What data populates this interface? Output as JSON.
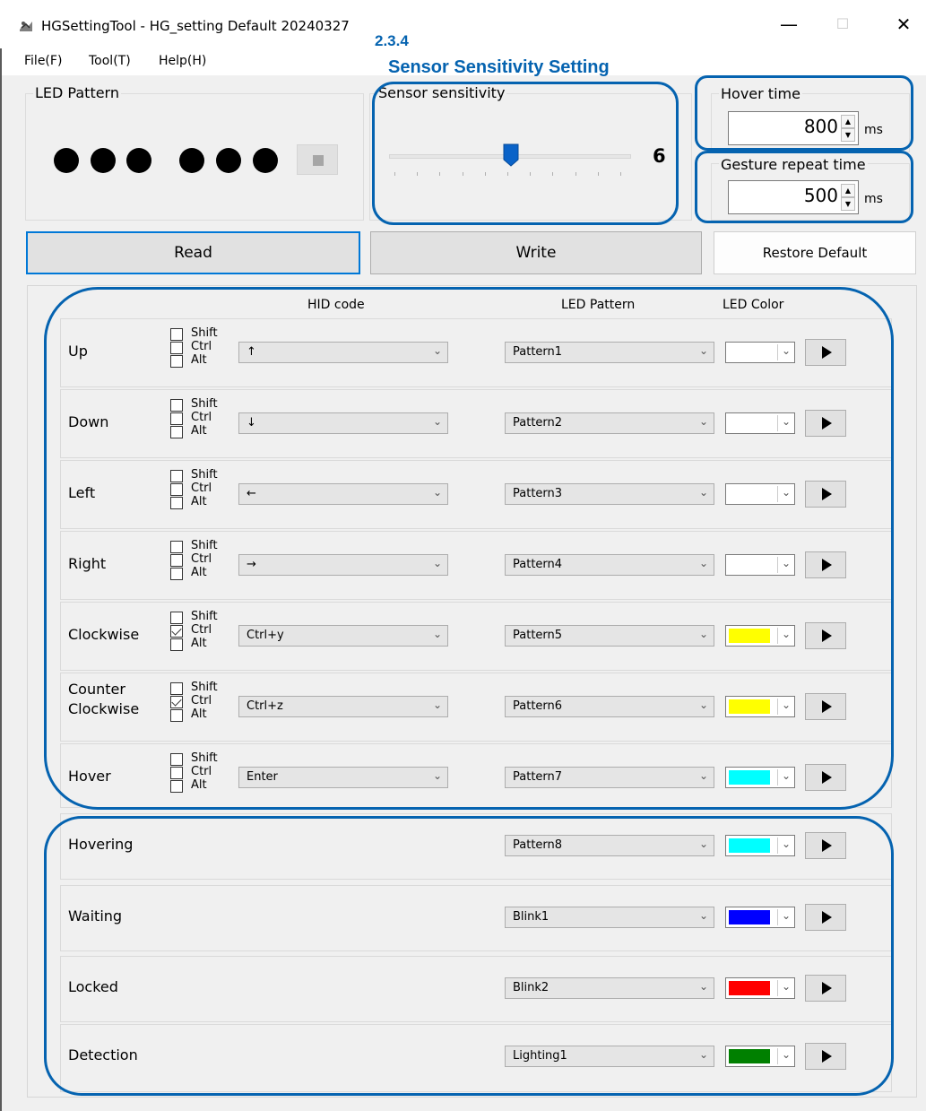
{
  "window": {
    "title": "HGSettingTool - HG_setting Default 20240327",
    "controls": {
      "minimize": "—",
      "maximize": "☐",
      "close": "✕"
    }
  },
  "menu": [
    "File(F)",
    "Tool(T)",
    "Help(H)"
  ],
  "annotation": {
    "number": "2.3.4",
    "title": "Sensor Sensitivity Setting",
    "color": "#0563b0"
  },
  "led_pattern": {
    "title": "LED Pattern"
  },
  "sensor": {
    "title": "Sensor sensitivity",
    "value": "6",
    "level": 6,
    "min": 1,
    "max": 11
  },
  "hover_time": {
    "title": "Hover time",
    "value": "800",
    "unit": "ms"
  },
  "gesture_repeat": {
    "title": "Gesture repeat time",
    "value": "500",
    "unit": "ms"
  },
  "buttons": {
    "read": "Read",
    "write": "Write",
    "restore": "Restore Default"
  },
  "columns": {
    "hid": "HID code",
    "led_pattern": "LED Pattern",
    "led_color": "LED Color"
  },
  "modifiers": [
    "Shift",
    "Ctrl",
    "Alt"
  ],
  "gestures": [
    {
      "label": "Up",
      "ctrl_checked": false,
      "hid": "↑",
      "pattern": "Pattern1",
      "color": "#ffffff"
    },
    {
      "label": "Down",
      "ctrl_checked": false,
      "hid": "↓",
      "pattern": "Pattern2",
      "color": "#ffffff"
    },
    {
      "label": "Left",
      "ctrl_checked": false,
      "hid": "←",
      "pattern": "Pattern3",
      "color": "#ffffff"
    },
    {
      "label": "Right",
      "ctrl_checked": false,
      "hid": "→",
      "pattern": "Pattern4",
      "color": "#ffffff"
    },
    {
      "label": "Clockwise",
      "ctrl_checked": true,
      "hid": "Ctrl+y",
      "pattern": "Pattern5",
      "color": "#ffff00"
    },
    {
      "label": "Counter\nClockwise",
      "ctrl_checked": true,
      "hid": "Ctrl+z",
      "pattern": "Pattern6",
      "color": "#ffff00"
    },
    {
      "label": "Hover",
      "ctrl_checked": false,
      "hid": "Enter",
      "pattern": "Pattern7",
      "color": "#00ffff"
    }
  ],
  "states": [
    {
      "label": "Hovering",
      "pattern": "Pattern8",
      "color": "#00ffff"
    },
    {
      "label": "Waiting",
      "pattern": "Blink1",
      "color": "#0000ff"
    },
    {
      "label": "Locked",
      "pattern": "Blink2",
      "color": "#ff0000"
    },
    {
      "label": "Detection",
      "pattern": "Lighting1",
      "color": "#008000"
    }
  ],
  "chevron": "⌄"
}
